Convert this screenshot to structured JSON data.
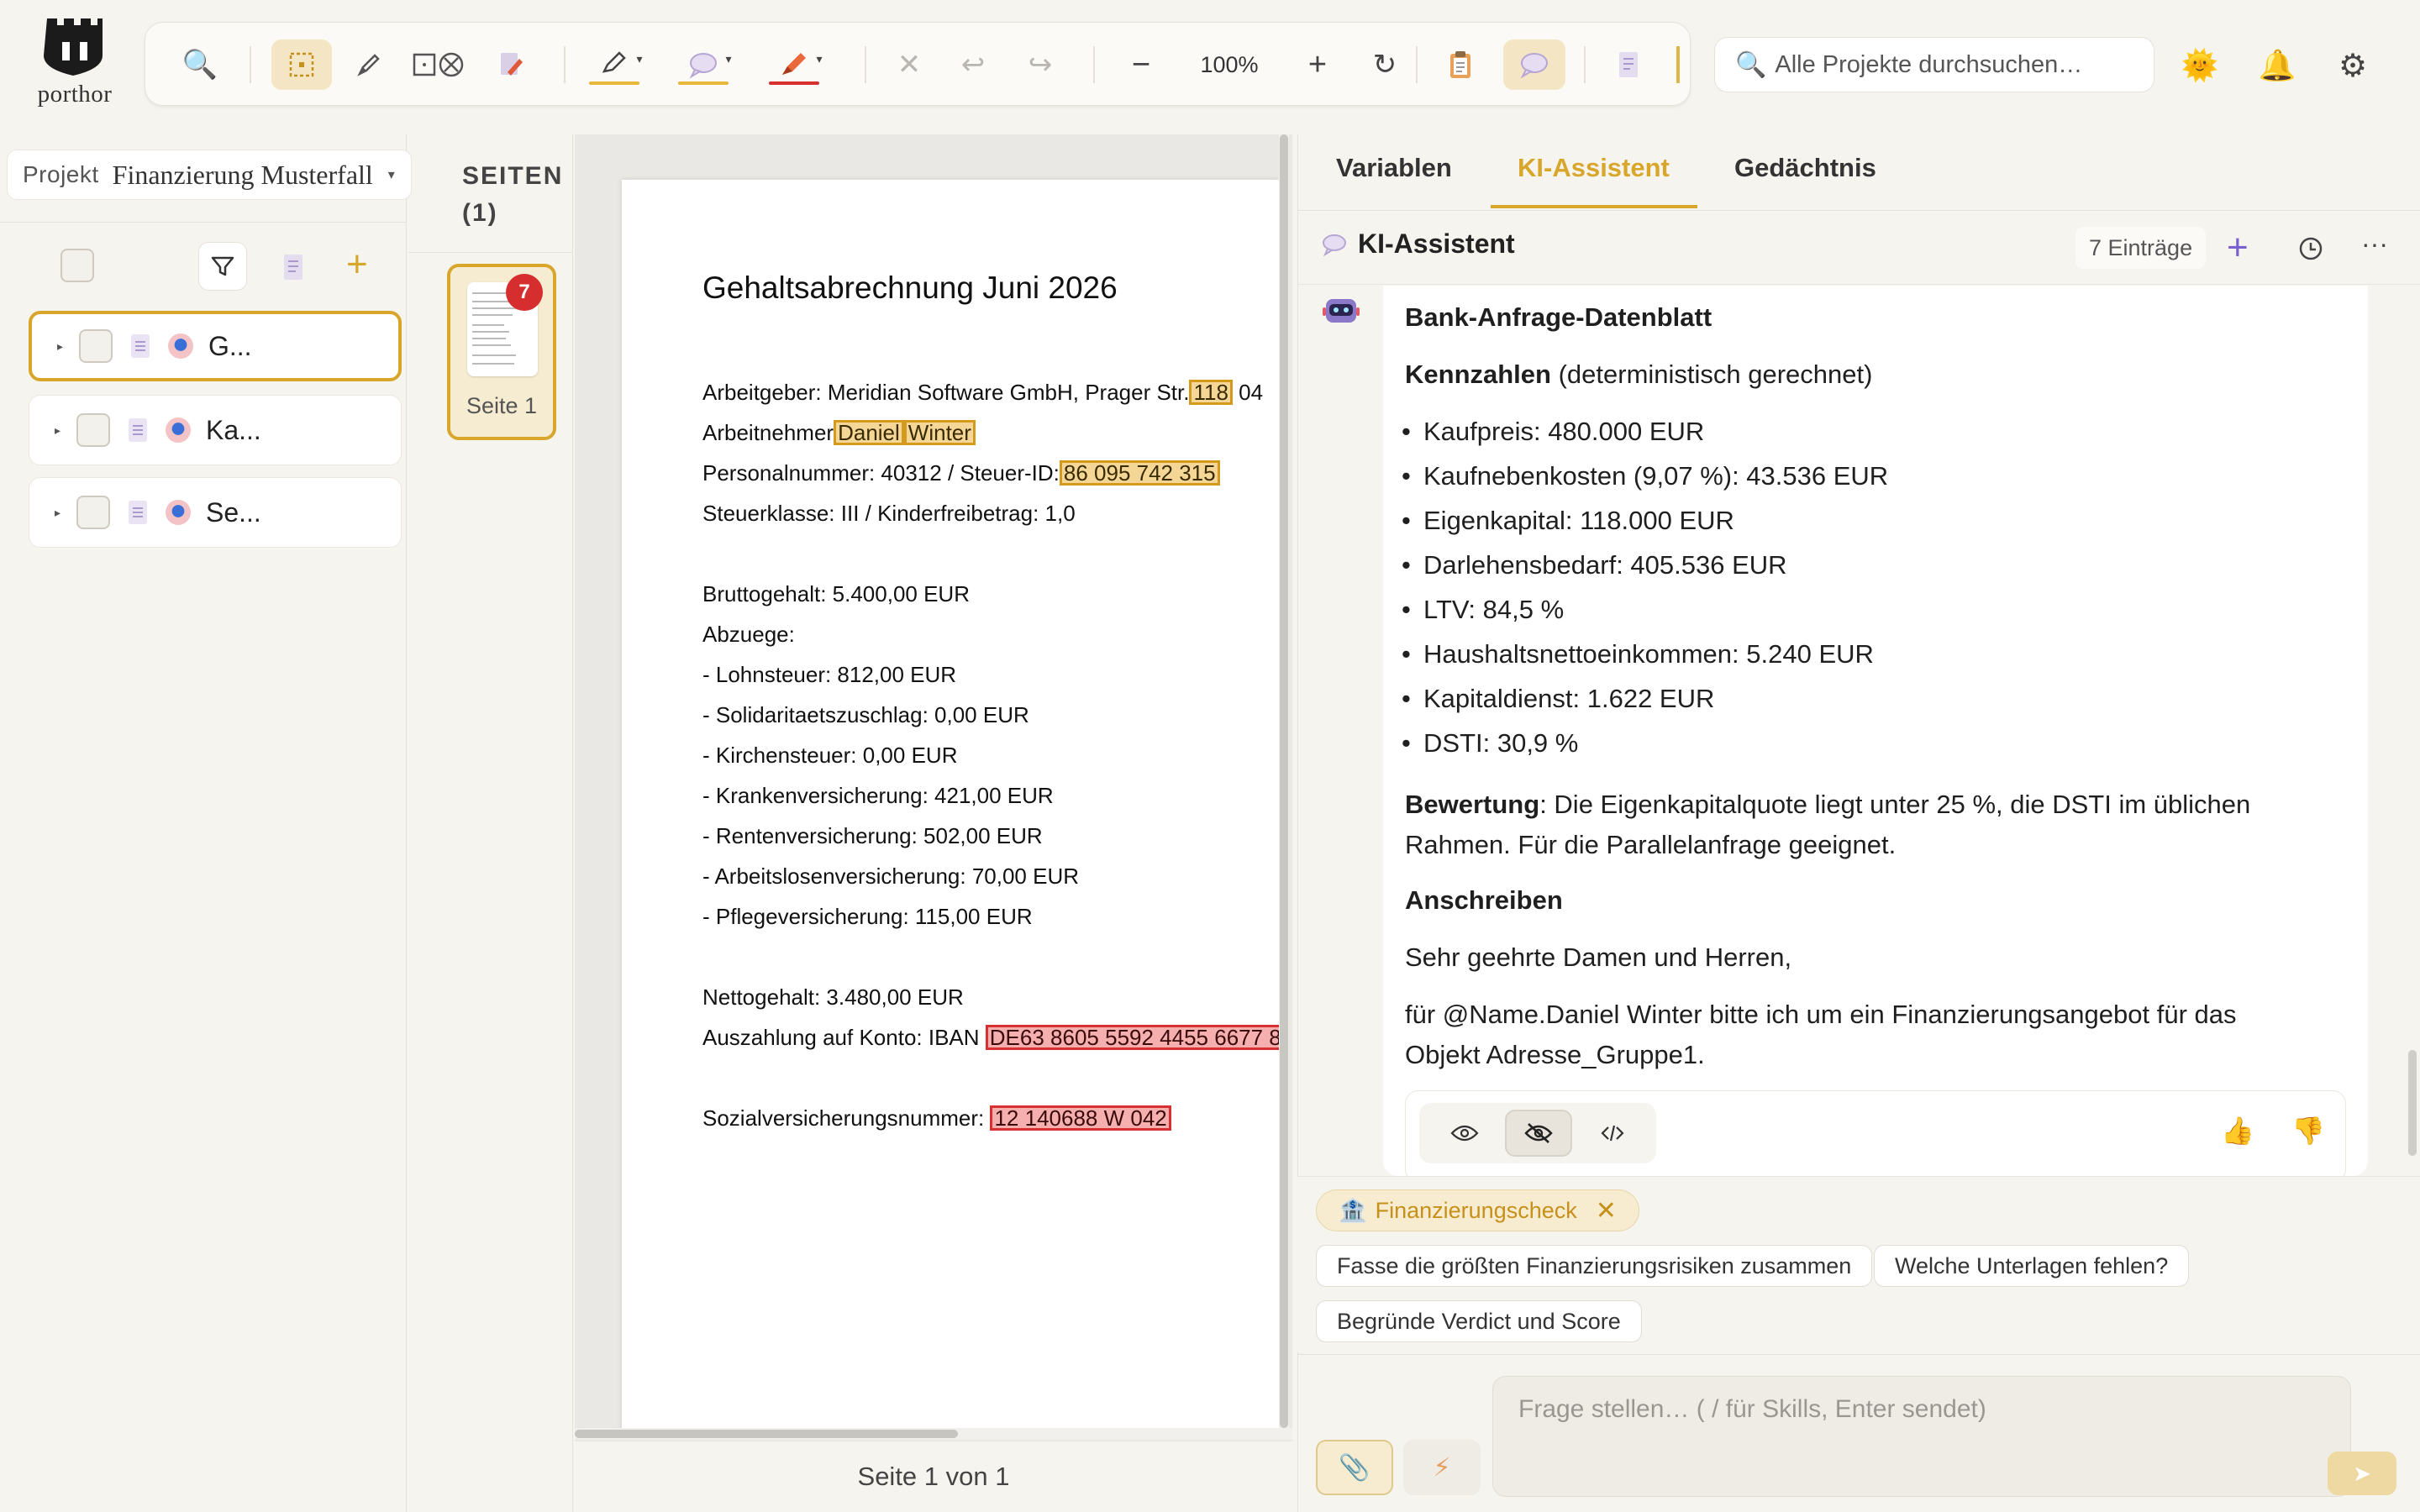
{
  "app": {
    "brand": "porthor"
  },
  "toolbar": {
    "zoom": "100%"
  },
  "search": {
    "placeholder": "Alle Projekte durchsuchen…"
  },
  "project": {
    "label": "Projekt",
    "name": "Finanzierung Musterfall"
  },
  "documents": [
    {
      "label": "G..."
    },
    {
      "label": "Ka..."
    },
    {
      "label": "Se..."
    }
  ],
  "pages": {
    "title_line1": "SEITEN",
    "title_line2": "(1)",
    "thumb_label": "Seite 1",
    "badge": "7",
    "footer": "Seite 1 von 1"
  },
  "document": {
    "title": "Gehaltsabrechnung Juni 2026",
    "employer_prefix": "Arbeitgeber: Meridian Software GmbH, Prager Str.",
    "employer_hl": "118",
    "employer_suffix": " 04",
    "employee_prefix": "Arbeitnehmer",
    "employee_hl1": "Daniel",
    "employee_hl2": "Winter",
    "personal_prefix": "Personalnummer: 40312 / Steuer-ID:",
    "personal_hl": "86 095 742 315",
    "tax_class": "Steuerklasse: III / Kinderfreibetrag: 1,0",
    "gross": "Bruttogehalt: 5.400,00 EUR",
    "deductions_title": "Abzuege:",
    "deductions": [
      "- Lohnsteuer: 812,00 EUR",
      "- Solidaritaetszuschlag: 0,00 EUR",
      "- Kirchensteuer: 0,00 EUR",
      "- Krankenversicherung: 421,00 EUR",
      "- Rentenversicherung: 502,00 EUR",
      "- Arbeitslosenversicherung: 70,00 EUR",
      "- Pflegeversicherung: 115,00 EUR"
    ],
    "net": "Nettogehalt: 3.480,00 EUR",
    "payout_prefix": "Auszahlung auf Konto: IBAN ",
    "payout_hl": "DE63 8605 5592 4455 6677 8",
    "ssn_prefix": "Sozialversicherungsnummer: ",
    "ssn_hl": "12 140688 W 042"
  },
  "right_tabs": [
    "Variablen",
    "KI-Assistent",
    "Gedächtnis"
  ],
  "assistant": {
    "title": "KI-Assistent",
    "entries": "7 Einträge",
    "heading": "Bank-Anfrage-Datenblatt",
    "kpi_title": "Kennzahlen",
    "kpi_note": " (deterministisch gerechnet)",
    "kpis": [
      "Kaufpreis: 480.000 EUR",
      "Kaufnebenkosten (9,07 %): 43.536 EUR",
      "Eigenkapital: 118.000 EUR",
      "Darlehensbedarf: 405.536 EUR",
      "LTV: 84,5 %",
      "Haushaltsnettoeinkommen: 5.240 EUR",
      "Kapitaldienst: 1.622 EUR",
      "DSTI: 30,9 %"
    ],
    "rating_title": "Bewertung",
    "rating_line1": ": Die Eigenkapitalquote liegt unter 25 %, die DSTI im üblichen",
    "rating_line2": "Rahmen. Für die Parallelanfrage geeignet.",
    "letter_title": "Anschreiben",
    "greeting": "Sehr geehrte Damen und Herren,",
    "letter_line1": "für @Name.Daniel Winter bitte ich um ein Finanzierungsangebot für das",
    "letter_line2": "Objekt Adresse_Gruppe1."
  },
  "skill_chip": "Finanzierungscheck",
  "suggestions": [
    "Fasse die größten Finanzierungsrisiken zusammen",
    "Welche Unterlagen fehlen?",
    "Begründe Verdict und Score"
  ],
  "chat": {
    "placeholder": "Frage stellen… ( / für Skills, Enter sendet)"
  },
  "colors": {
    "accent": "#d9a62c",
    "redact_red": "#d63030",
    "highlight_yellow": "#d49a1d",
    "badge_red": "#d62e2e"
  }
}
